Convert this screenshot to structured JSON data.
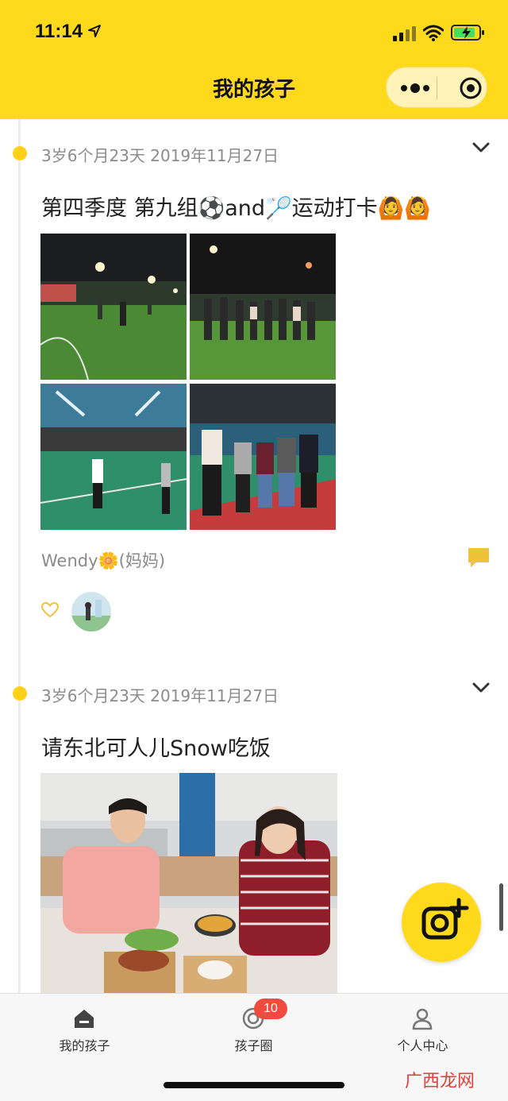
{
  "status_bar": {
    "time": "11:14"
  },
  "nav": {
    "title": "我的孩子"
  },
  "posts": [
    {
      "date": "3岁6个月23天 2019年11月27日",
      "text": "第四季度 第九组⚽and🏸运动打卡🙆🙆",
      "author": "Wendy🌼(妈妈)"
    },
    {
      "date": "3岁6个月23天 2019年11月27日",
      "text": "请东北可人儿Snow吃饭"
    }
  ],
  "tabs": [
    {
      "label": "我的孩子",
      "icon": "home-icon"
    },
    {
      "label": "孩子圈",
      "icon": "circle-icon",
      "badge": "10"
    },
    {
      "label": "个人中心",
      "icon": "person-icon"
    }
  ],
  "watermark": "广西龙网",
  "colors": {
    "accent": "#FFD91C",
    "timeline_dot": "#FFD11A",
    "badge": "#F04B3E",
    "watermark": "#E2403A"
  }
}
